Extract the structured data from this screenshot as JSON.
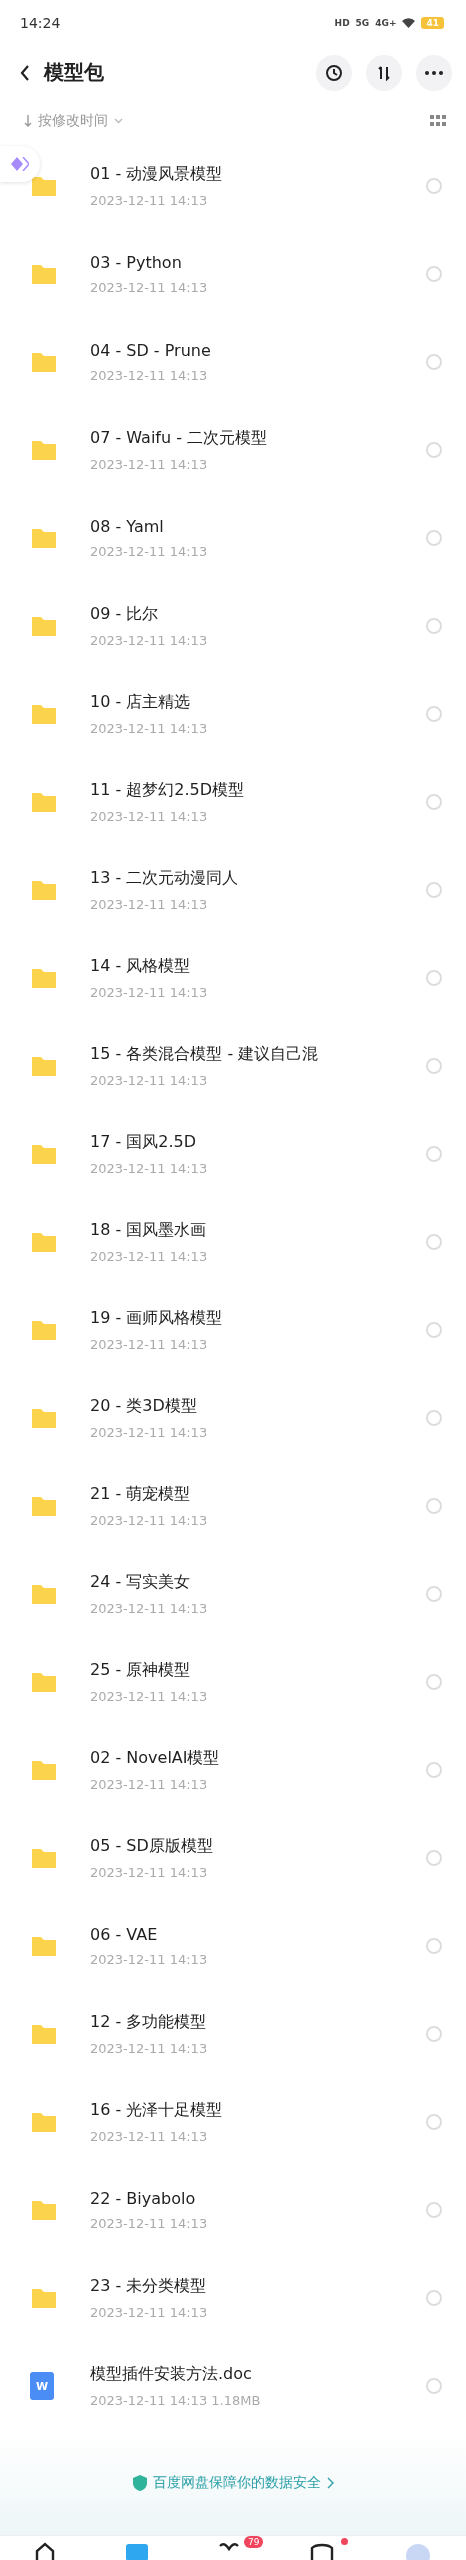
{
  "status_bar": {
    "time": "14:24",
    "indicators": [
      "HD",
      "5G",
      "4G+"
    ],
    "battery": "41"
  },
  "header": {
    "title": "模型包"
  },
  "sort": {
    "label": "按修改时间"
  },
  "files": [
    {
      "kind": "folder",
      "name": "01 - 动漫风景模型",
      "meta": "2023-12-11  14:13",
      "selected": false
    },
    {
      "kind": "folder",
      "name": "03 - Python",
      "meta": "2023-12-11  14:13",
      "selected": false
    },
    {
      "kind": "folder",
      "name": "04 - SD - Prune",
      "meta": "2023-12-11  14:13",
      "selected": false
    },
    {
      "kind": "folder",
      "name": "07 - Waifu - 二次元模型",
      "meta": "2023-12-11  14:13",
      "selected": false
    },
    {
      "kind": "folder",
      "name": "08 - Yaml",
      "meta": "2023-12-11  14:13",
      "selected": false
    },
    {
      "kind": "folder",
      "name": "09 - 比尔",
      "meta": "2023-12-11  14:13",
      "selected": false
    },
    {
      "kind": "folder",
      "name": "10 - 店主精选",
      "meta": "2023-12-11  14:13",
      "selected": false
    },
    {
      "kind": "folder",
      "name": "11 - 超梦幻2.5D模型",
      "meta": "2023-12-11  14:13",
      "selected": false
    },
    {
      "kind": "folder",
      "name": "13 - 二次元动漫同人",
      "meta": "2023-12-11  14:13",
      "selected": false
    },
    {
      "kind": "folder",
      "name": "14 - 风格模型",
      "meta": "2023-12-11  14:13",
      "selected": false
    },
    {
      "kind": "folder",
      "name": "15 - 各类混合模型 - 建议自己混",
      "meta": "2023-12-11  14:13",
      "selected": false
    },
    {
      "kind": "folder",
      "name": "17 - 国风2.5D",
      "meta": "2023-12-11  14:13",
      "selected": false
    },
    {
      "kind": "folder",
      "name": "18 - 国风墨水画",
      "meta": "2023-12-11  14:13",
      "selected": false
    },
    {
      "kind": "folder",
      "name": "19 - 画师风格模型",
      "meta": "2023-12-11  14:13",
      "selected": false
    },
    {
      "kind": "folder",
      "name": "20 - 类3D模型",
      "meta": "2023-12-11  14:13",
      "selected": false
    },
    {
      "kind": "folder",
      "name": "21 - 萌宠模型",
      "meta": "2023-12-11  14:13",
      "selected": false
    },
    {
      "kind": "folder",
      "name": "24 - 写实美女",
      "meta": "2023-12-11  14:13",
      "selected": false
    },
    {
      "kind": "folder",
      "name": "25 - 原神模型",
      "meta": "2023-12-11  14:13",
      "selected": false
    },
    {
      "kind": "folder",
      "name": "02 - NovelAI模型",
      "meta": "2023-12-11  14:13",
      "selected": false
    },
    {
      "kind": "folder",
      "name": "05 - SD原版模型",
      "meta": "2023-12-11  14:13",
      "selected": false
    },
    {
      "kind": "folder",
      "name": "06 - VAE",
      "meta": "2023-12-11  14:13",
      "selected": false
    },
    {
      "kind": "folder",
      "name": "12 - 多功能模型",
      "meta": "2023-12-11  14:13",
      "selected": false
    },
    {
      "kind": "folder",
      "name": "16 - 光泽十足模型",
      "meta": "2023-12-11  14:13",
      "selected": false
    },
    {
      "kind": "folder",
      "name": "22 - Biyabolo",
      "meta": "2023-12-11  14:13",
      "selected": false
    },
    {
      "kind": "folder",
      "name": "23 - 未分类模型",
      "meta": "2023-12-11  14:13",
      "selected": false
    },
    {
      "kind": "doc",
      "name": "模型插件安装方法.doc",
      "meta": "2023-12-11  14:13  1.18MB",
      "icon_label": "W",
      "selected": false
    }
  ],
  "footer": {
    "text": "百度网盘保障你的数据安全"
  },
  "tab_bar": {
    "badge": "79"
  }
}
